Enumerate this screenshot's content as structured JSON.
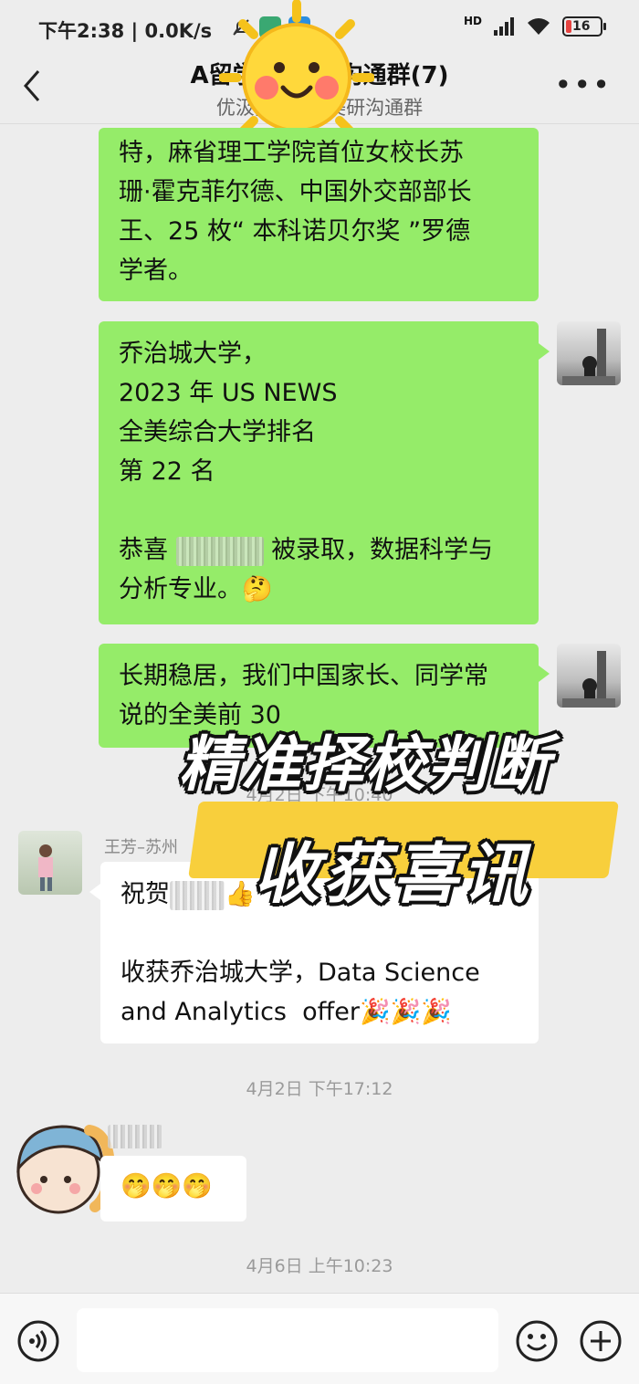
{
  "status": {
    "time": "下午2:38 | 0.0K/s",
    "network": "HD",
    "battery": "16"
  },
  "header": {
    "title": "A留学–英美研沟通群(7)",
    "subtitle": "优汲国际–22美研沟通群",
    "back_icon": "chevron-left-icon",
    "more_icon": "more-dots-icon"
  },
  "messages": [
    {
      "side": "right",
      "lines": [
        "特，麻省理工学院首位女校长苏",
        "珊·霍克菲尔德、中国外交部部长",
        "王、25 枚“ 本科诺贝尔奖 ”罗德",
        "学者。"
      ]
    },
    {
      "side": "right",
      "lines": [
        "乔治城大学，",
        "2023 年 US NEWS",
        "全美综合大学排名",
        "第 22 名",
        "",
        "恭喜",
        "被录取，数据科学与",
        "分析专业。"
      ],
      "emoji": "🤔"
    },
    {
      "side": "right",
      "lines": [
        "长期稳居，我们中国家长、同学常",
        "说的全美前 30"
      ]
    },
    {
      "side": "left",
      "sender": "王芳–苏州",
      "lines": [
        "祝贺",
        "收获乔治城大学，Data Science",
        "and Analytics  offer"
      ],
      "emoji": "👍",
      "trail": "🎉🎉🎉"
    },
    {
      "side": "left",
      "lines": [
        "🤭🤭🤭"
      ]
    }
  ],
  "timestamps": [
    "4月2日 下午10:40",
    "4月2日 下午17:12",
    "4月6日 上午10:23"
  ],
  "overlay": {
    "line1": "精准择校判断",
    "line2": "收获喜讯"
  },
  "input_bar": {
    "placeholder": "",
    "voice_icon": "voice-icon",
    "emoji_icon": "emoji-icon",
    "plus_icon": "plus-icon"
  },
  "colors": {
    "sent_bubble": "#95ec69",
    "received_bubble": "#ffffff",
    "background": "#ededed",
    "highlight": "#f8cf3c"
  }
}
